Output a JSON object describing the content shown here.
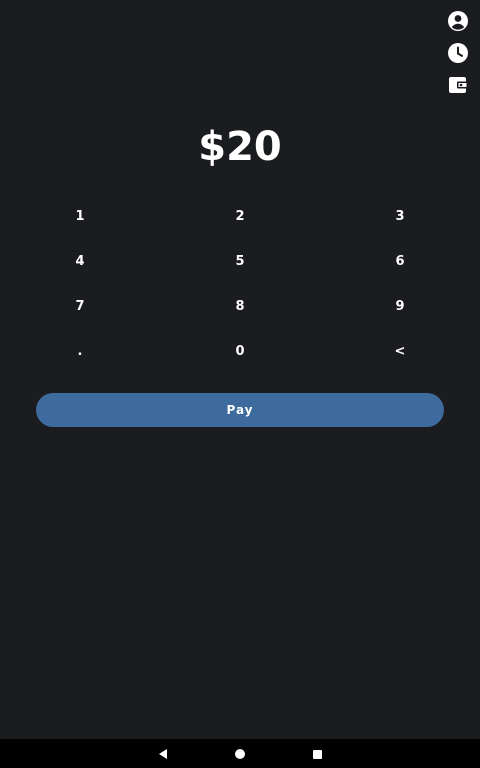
{
  "side_icons": [
    "account-circle-icon",
    "history-clock-icon",
    "wallet-icon"
  ],
  "amount": "$20",
  "keypad": {
    "keys": [
      "1",
      "2",
      "3",
      "4",
      "5",
      "6",
      "7",
      "8",
      "9",
      ".",
      "0",
      "<"
    ]
  },
  "pay_button": {
    "label": "Pay"
  },
  "nav_bar": {
    "icons": [
      "back-icon",
      "home-icon",
      "recents-icon"
    ]
  },
  "colors": {
    "background": "#1b1c20",
    "accent": "#3d6b9e",
    "text": "#ffffff"
  }
}
